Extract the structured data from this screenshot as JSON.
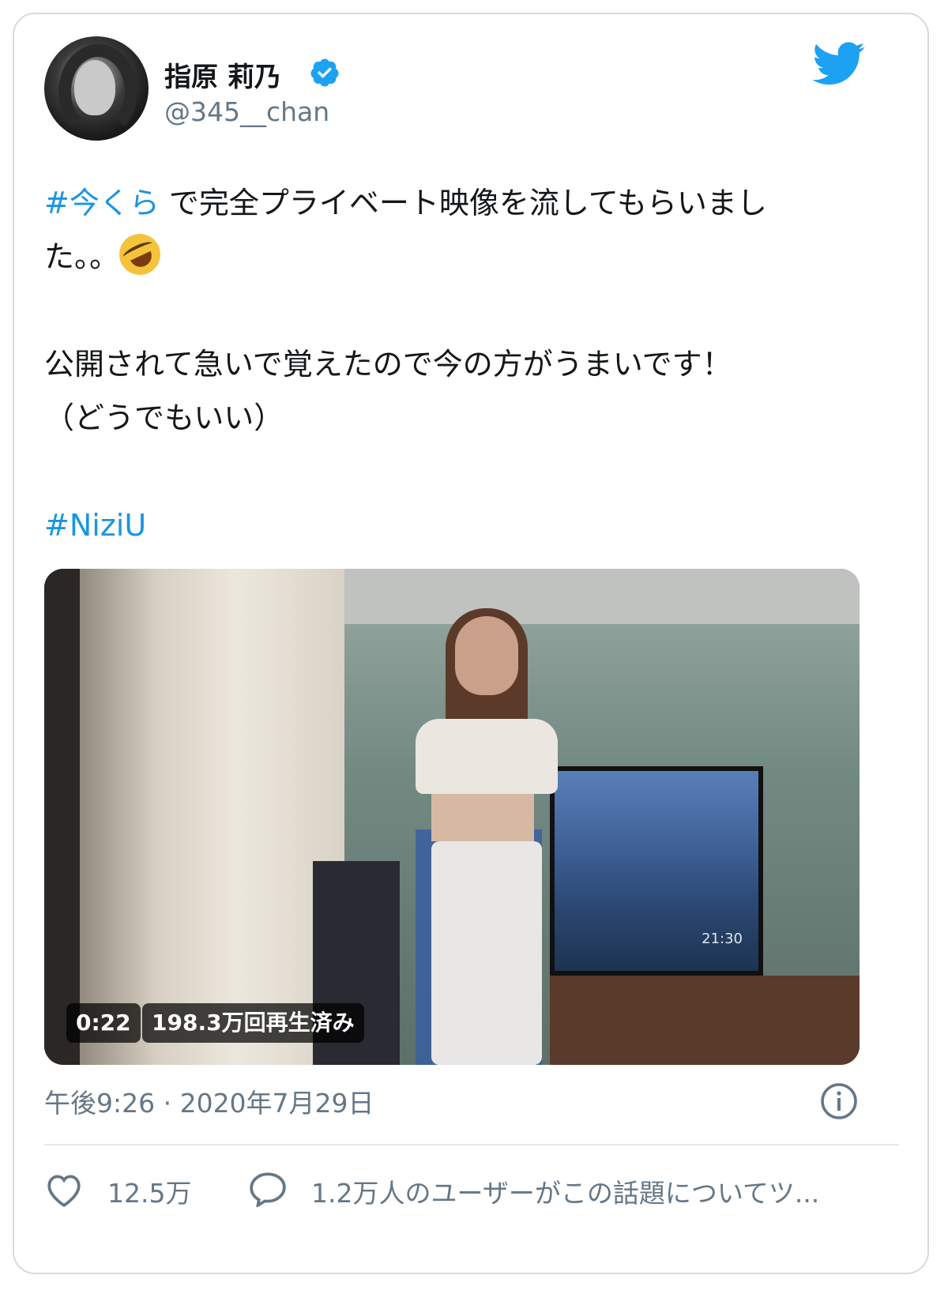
{
  "author": {
    "name": "指原 莉乃",
    "handle": "@345__chan",
    "verified": true
  },
  "tweet": {
    "hashtag1": "#今くら",
    "line1_rest": " で完全プライベート映像を流してもらいまし",
    "line2": "た。。",
    "line3": "公開されて急いで覚えたので今の方がうまいです！",
    "line4": "（どうでもいい）",
    "hashtag2": "#NiziU"
  },
  "video": {
    "duration": "0:22",
    "views": "198.3万回再生済み",
    "tv_clock": "21:30"
  },
  "footer": {
    "timestamp": "午後9:26 · 2020年7月29日",
    "likes": "12.5万",
    "topic": "1.2万人のユーザーがこの話題についてツ..."
  },
  "colors": {
    "link": "#1b95e0",
    "secondary_text": "#657786",
    "border": "#e1e8ed"
  },
  "icons": [
    "avatar",
    "verified-badge-icon",
    "twitter-logo-icon",
    "face-with-tears-of-joy-emoji",
    "info-icon",
    "heart-icon",
    "reply-icon"
  ]
}
